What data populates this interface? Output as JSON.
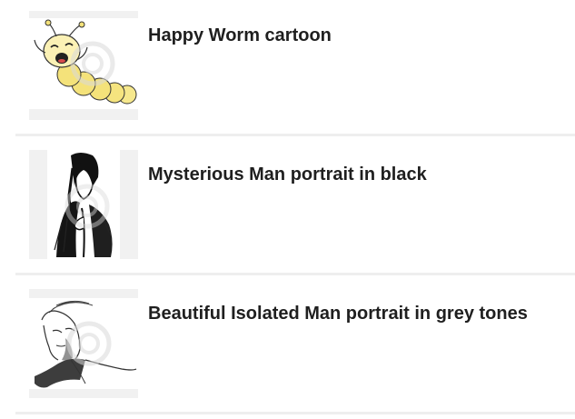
{
  "results": [
    {
      "title": "Happy Worm cartoon",
      "thumbnail_icon": "happy-worm-illustration"
    },
    {
      "title": "Mysterious Man portrait in black",
      "thumbnail_icon": "mysterious-man-illustration"
    },
    {
      "title": "Beautiful Isolated Man portrait in grey tones",
      "thumbnail_icon": "grey-man-portrait-illustration"
    }
  ],
  "colors": {
    "title_text": "#1f1f1f",
    "thumbnail_bg": "#f1f1f1",
    "divider": "#eeeeee",
    "worm_yellow": "#f4e27a"
  }
}
